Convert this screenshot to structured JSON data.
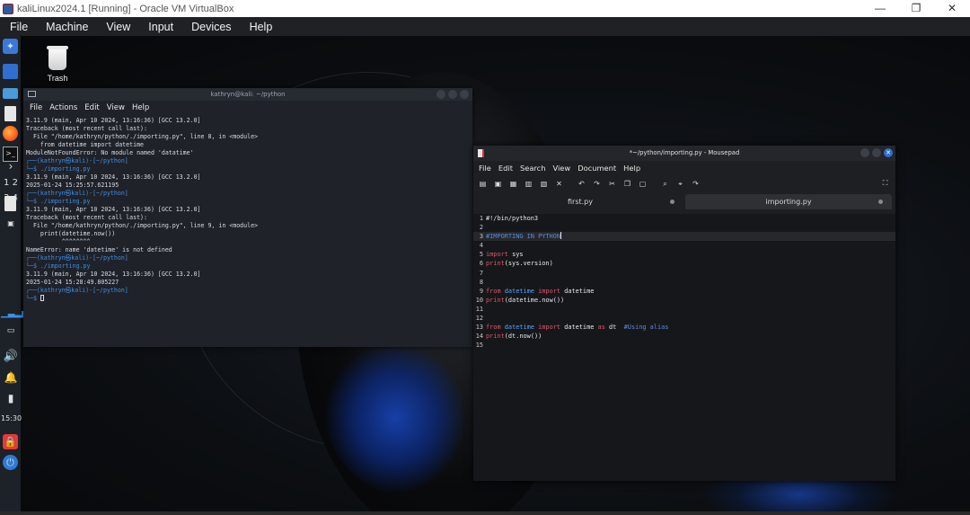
{
  "host": {
    "title": "kaliLinux2024.1 [Running] - Oracle VM VirtualBox",
    "menu": [
      "File",
      "Machine",
      "View",
      "Input",
      "Devices",
      "Help"
    ],
    "window_buttons": [
      "—",
      "❐",
      "✕"
    ]
  },
  "panel": {
    "workspaces": "1 2 3 4",
    "clock": "15:30"
  },
  "desktop": {
    "trash_label": "Trash"
  },
  "terminal": {
    "title": "kathryn@kali: ~/python",
    "menu": [
      "File",
      "Actions",
      "Edit",
      "View",
      "Help"
    ],
    "lines": [
      "3.11.9 (main, Apr 10 2024, 13:16:36) [GCC 13.2.0]",
      "Traceback (most recent call last):",
      "  File \"/home/kathryn/python/./importing.py\", line 8, in <module>",
      "    from datetime import datetime",
      "ModuleNotFoundError: No module named 'datatime'",
      "",
      "┌──(kathryn㉿kali)-[~/python]",
      "└─$ ./importing.py",
      "3.11.9 (main, Apr 10 2024, 13:16:36) [GCC 13.2.0]",
      "2025-01-24 15:25:57.621195",
      "",
      "┌──(kathryn㉿kali)-[~/python]",
      "└─$ ./importing.py",
      "3.11.9 (main, Apr 10 2024, 13:16:36) [GCC 13.2.0]",
      "Traceback (most recent call last):",
      "  File \"/home/kathryn/python/./importing.py\", line 9, in <module>",
      "    print(datetime.now())",
      "          ^^^^^^^^",
      "NameError: name 'datetime' is not defined",
      "",
      "┌──(kathryn㉿kali)-[~/python]",
      "└─$ ./importing.py",
      "3.11.9 (main, Apr 10 2024, 13:16:36) [GCC 13.2.0]",
      "2025-01-24 15:28:49.805227",
      "",
      "┌──(kathryn㉿kali)-[~/python]",
      "└─$ "
    ]
  },
  "mousepad": {
    "title": "*~/python/importing.py - Mousepad",
    "menu": [
      "File",
      "Edit",
      "Search",
      "View",
      "Document",
      "Help"
    ],
    "tabs": [
      {
        "label": "first.py",
        "active": false
      },
      {
        "label": "importing.py",
        "active": true
      }
    ],
    "code": [
      {
        "n": "1",
        "text": "#!/bin/python3"
      },
      {
        "n": "2",
        "text": ""
      },
      {
        "n": "3",
        "text": "#IMPORTING IN PYTHON"
      },
      {
        "n": "4",
        "text": ""
      },
      {
        "n": "5",
        "text": "import sys"
      },
      {
        "n": "6",
        "text": "print(sys.version)"
      },
      {
        "n": "7",
        "text": ""
      },
      {
        "n": "8",
        "text": ""
      },
      {
        "n": "9",
        "text": "from datetime import datetime"
      },
      {
        "n": "10",
        "text": "print(datetime.now())"
      },
      {
        "n": "11",
        "text": ""
      },
      {
        "n": "12",
        "text": ""
      },
      {
        "n": "13",
        "text": "from datetime import datetime as dt  #Using alias"
      },
      {
        "n": "14",
        "text": "print(dt.now())"
      },
      {
        "n": "15",
        "text": ""
      }
    ]
  }
}
